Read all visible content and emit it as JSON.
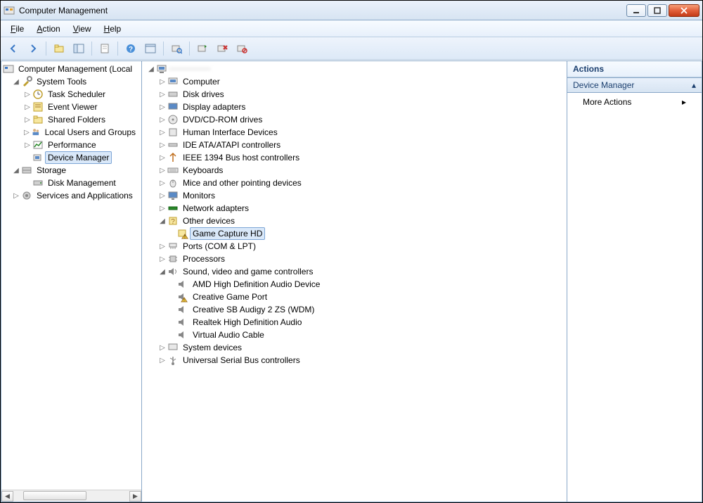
{
  "window": {
    "title": "Computer Management"
  },
  "menu": {
    "file": "File",
    "action": "Action",
    "view": "View",
    "help": "Help"
  },
  "toolbar_icons": [
    "back",
    "forward",
    "up",
    "show-hide",
    "export",
    "help",
    "properties",
    "find",
    "refresh",
    "remove",
    "scan"
  ],
  "left_tree": {
    "root": "Computer Management (Local",
    "system_tools": "System Tools",
    "task_scheduler": "Task Scheduler",
    "event_viewer": "Event Viewer",
    "shared_folders": "Shared Folders",
    "local_users": "Local Users and Groups",
    "performance": "Performance",
    "device_manager": "Device Manager",
    "storage": "Storage",
    "disk_management": "Disk Management",
    "services_apps": "Services and Applications"
  },
  "device_tree": {
    "root": "",
    "computer": "Computer",
    "disk_drives": "Disk drives",
    "display_adapters": "Display adapters",
    "dvd": "DVD/CD-ROM drives",
    "hid": "Human Interface Devices",
    "ide": "IDE ATA/ATAPI controllers",
    "ieee1394": "IEEE 1394 Bus host controllers",
    "keyboards": "Keyboards",
    "mice": "Mice and other pointing devices",
    "monitors": "Monitors",
    "network": "Network adapters",
    "other_devices": "Other devices",
    "game_capture": "Game Capture HD",
    "ports": "Ports (COM & LPT)",
    "processors": "Processors",
    "sound": "Sound, video and game controllers",
    "amd_hd": "AMD High Definition Audio Device",
    "creative_port": "Creative Game Port",
    "creative_sb": "Creative SB Audigy 2 ZS (WDM)",
    "realtek": "Realtek High Definition Audio",
    "virtual_cable": "Virtual Audio Cable",
    "system_devices": "System devices",
    "usb": "Universal Serial Bus controllers"
  },
  "actions": {
    "header": "Actions",
    "section": "Device Manager",
    "more": "More Actions"
  }
}
